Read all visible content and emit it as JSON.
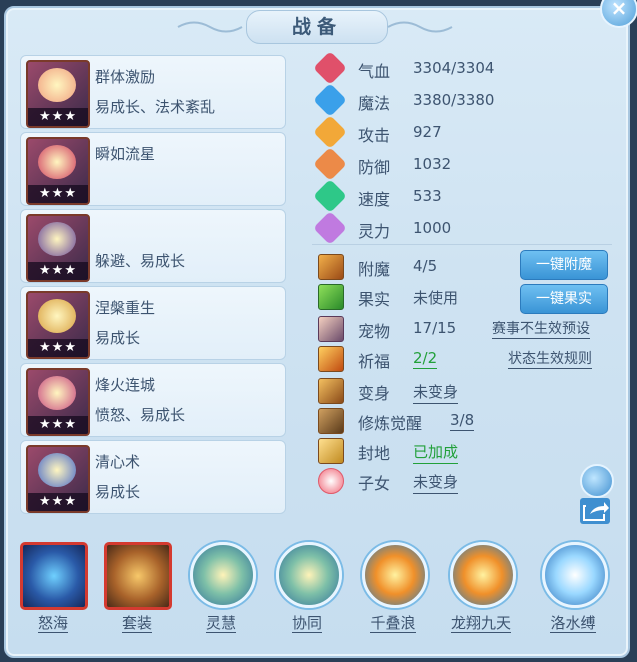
{
  "title": "战备",
  "close_icon": "close-icon",
  "skills": [
    {
      "name": "群体激励",
      "desc": "易成长、法术紊乱",
      "stars": "★★★",
      "icon": "popsicle-skill-icon",
      "color": "#f0a080"
    },
    {
      "name": "瞬如流星",
      "desc": "",
      "stars": "★★★",
      "icon": "meteor-skill-icon",
      "color": "#d04060"
    },
    {
      "name": "",
      "desc": "躲避、易成长",
      "stars": "★★★",
      "icon": "masked-warrior-skill-icon",
      "color": "#6a4a9a"
    },
    {
      "name": "涅槃重生",
      "desc": "易成长",
      "stars": "★★★",
      "icon": "golden-serpent-skill-icon",
      "color": "#d8a040"
    },
    {
      "name": "烽火连城",
      "desc": "愤怒、易成长",
      "stars": "★★★",
      "icon": "fire-cauldron-skill-icon",
      "color": "#c84a80"
    },
    {
      "name": "清心术",
      "desc": "易成长",
      "stars": "★★★",
      "icon": "robed-mage-skill-icon",
      "color": "#4a6ac8"
    }
  ],
  "stats": [
    {
      "label": "气血",
      "value": "3304/3304",
      "icon": "heart-icon",
      "color": "#e0506a"
    },
    {
      "label": "魔法",
      "value": "3380/3380",
      "icon": "water-drop-icon",
      "color": "#3aa0ea"
    },
    {
      "label": "攻击",
      "value": "927",
      "icon": "sword-icon",
      "color": "#f2a838"
    },
    {
      "label": "防御",
      "value": "1032",
      "icon": "shield-icon",
      "color": "#ec8a48"
    },
    {
      "label": "速度",
      "value": "533",
      "icon": "lightning-icon",
      "color": "#2ec888"
    },
    {
      "label": "灵力",
      "value": "1000",
      "icon": "spirit-icon",
      "color": "#c07ae0"
    }
  ],
  "attrs": {
    "enchant": {
      "label": "附魔",
      "value": "4/5",
      "icon": "enchant-icon"
    },
    "fruit": {
      "label": "果实",
      "value": "未使用",
      "icon": "fruit-icon"
    },
    "pet": {
      "label": "宠物",
      "value": "17/15",
      "icon": "pet-portrait-icon"
    },
    "blessing": {
      "label": "祈福",
      "value": "2/2",
      "icon": "blessing-icon"
    },
    "transform": {
      "label": "变身",
      "value": "未变身",
      "icon": "transform-icon"
    },
    "cultivation": {
      "label": "修炼觉醒",
      "value": "3/8",
      "icon": "cultivation-icon"
    },
    "fief": {
      "label": "封地",
      "value": "已加成",
      "icon": "fief-icon"
    },
    "children": {
      "label": "子女",
      "value": "未变身",
      "icon": "children-icon"
    }
  },
  "buttons": {
    "enchant": "一键附魔",
    "fruit": "一键果实"
  },
  "links": {
    "event_preset": "赛事不生效预设",
    "status_rules": "状态生效规则"
  },
  "side_icons": {
    "refresh": "refresh-icon",
    "share": "share-icon"
  },
  "bottom": [
    {
      "label": "怒海",
      "icon": "angry-sea-icon",
      "shape": "square",
      "variant": ""
    },
    {
      "label": "套装",
      "icon": "suit-icon",
      "shape": "square",
      "variant": "brown"
    },
    {
      "label": "灵慧",
      "icon": "wisdom-icon",
      "shape": "round",
      "variant": ""
    },
    {
      "label": "协同",
      "icon": "synergy-icon",
      "shape": "round",
      "variant": ""
    },
    {
      "label": "千叠浪",
      "icon": "wave-icon",
      "shape": "round",
      "variant": "fire"
    },
    {
      "label": "龙翔九天",
      "icon": "dragon-soar-icon",
      "shape": "round",
      "variant": "fire"
    },
    {
      "label": "洛水缚",
      "icon": "river-bind-icon",
      "shape": "round",
      "variant": "ice"
    }
  ]
}
